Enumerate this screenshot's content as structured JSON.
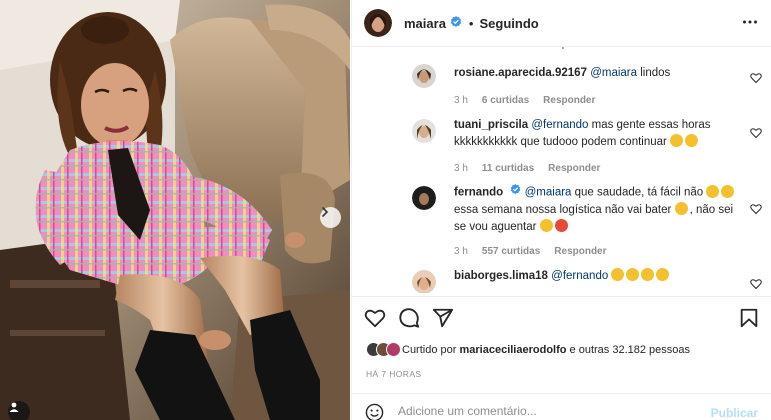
{
  "header": {
    "username": "maiara",
    "separator": "•",
    "follow_status": "Seguindo"
  },
  "comments": [
    {
      "username": "rosiane.aparecida.92167",
      "mention": "@maiara",
      "text": " lindos",
      "time": "3 h",
      "likes": "6 curtidas",
      "reply": "Responder"
    },
    {
      "username": "tuani_priscila",
      "mention": "@fernando",
      "text_line1": " mas gente essas horas",
      "text_line2": "kkkkkkkkkkk que tudooo podem continuar",
      "time": "3 h",
      "likes": "11 curtidas",
      "reply": "Responder"
    },
    {
      "username": "fernando",
      "mention": "@maiara",
      "text_line1": " que saudade, tá fácil não",
      "text_line2": "essa semana nossa logística não vai bater",
      "text_line2b": ", não sei",
      "text_line3": "se vou aguentar",
      "time": "3 h",
      "likes": "557 curtidas",
      "reply": "Responder"
    },
    {
      "username": "biaborges.lima18",
      "mention": "@fernando",
      "text": ""
    }
  ],
  "likes": {
    "prefix": "Curtido por",
    "top_liker": "maria​ceciliaerodolfo",
    "suffix": "e outras 32.182 pessoas"
  },
  "post_time": "HÁ 7 HORAS",
  "add_comment": {
    "placeholder": "Adicione um comentário...",
    "publish_label": "Publicar"
  },
  "icons": {
    "more": "more-horizontal-icon",
    "like": "heart-outline-icon",
    "comment": "comment-bubble-icon",
    "share": "paper-plane-icon",
    "save": "bookmark-icon",
    "emoji": "smiley-icon",
    "next": "chevron-right-icon",
    "tag": "user-tag-icon"
  },
  "colors": {
    "verified": "#3897f0",
    "mention": "#00376b",
    "meta": "#8e8e8e",
    "publish_disabled": "#b2dffc"
  }
}
